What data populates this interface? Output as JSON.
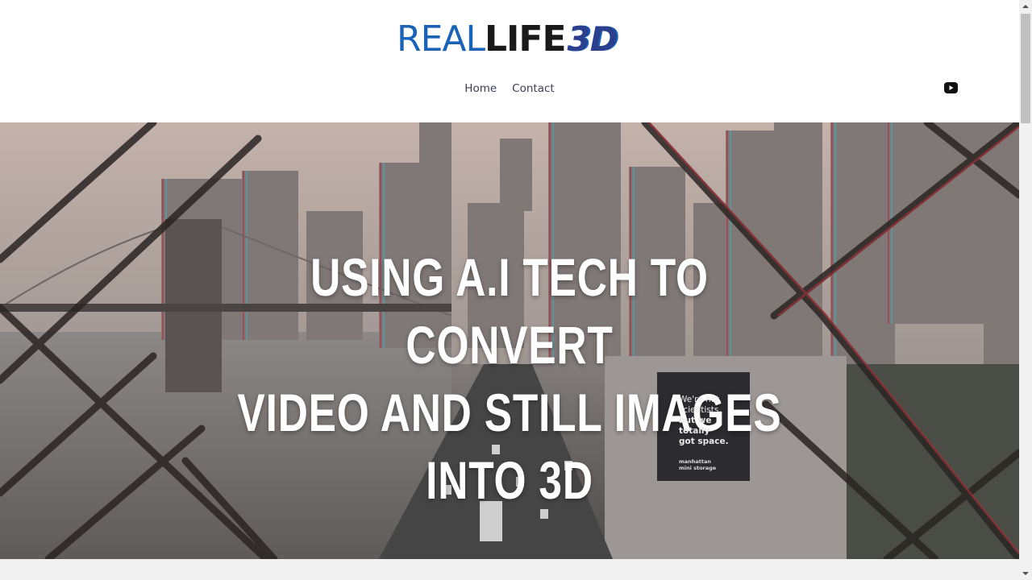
{
  "logo": {
    "real": "REAL",
    "life": "LIFE",
    "three_d": "3D"
  },
  "nav": {
    "items": [
      {
        "label": "Home"
      },
      {
        "label": "Contact"
      }
    ]
  },
  "social": {
    "icon": "youtube-icon"
  },
  "hero": {
    "title_line1": "USING A.I TECH TO CONVERT",
    "title_line2": "VIDEO AND STILL IMAGES",
    "title_line3": "INTO 3D",
    "billboard": {
      "line1": "We're not",
      "line2": "scientists,",
      "line3": "but we totally",
      "line4": "got space.",
      "brand_line1": "manhattan",
      "brand_line2": "mini storage"
    }
  },
  "colors": {
    "logo_blue": "#1b63b8",
    "logo_dark": "#1a1a1a",
    "nav_text": "#3a3f55",
    "hero_text": "#ffffff"
  }
}
